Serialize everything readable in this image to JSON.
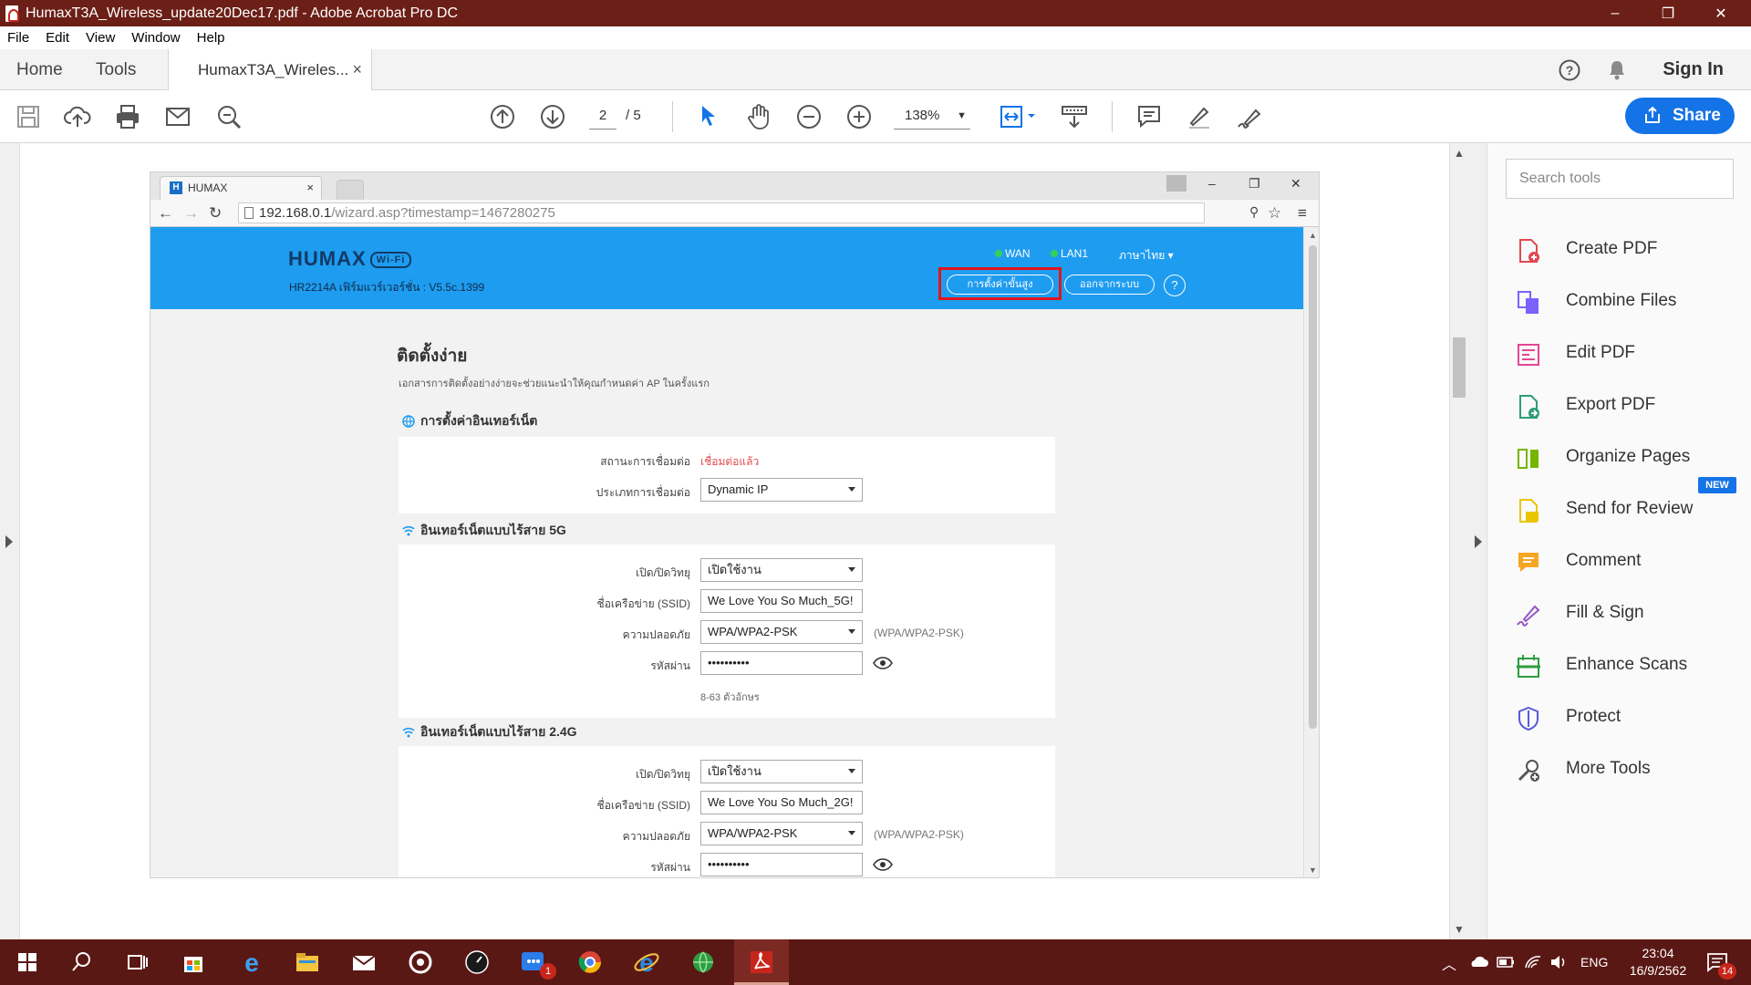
{
  "window": {
    "title": "HumaxT3A_Wireless_update20Dec17.pdf - Adobe Acrobat Pro DC",
    "controls": [
      "–",
      "❐",
      "✕"
    ]
  },
  "menu": [
    "File",
    "Edit",
    "View",
    "Window",
    "Help"
  ],
  "tabs": {
    "home": "Home",
    "tools": "Tools",
    "document": "HumaxT3A_Wireles...",
    "close": "×",
    "sign_in": "Sign In"
  },
  "toolbar": {
    "page_current": "2",
    "page_total": "/ 5",
    "zoom": "138%",
    "share": "Share"
  },
  "screenshot": {
    "browser": {
      "tab_title": "HUMAX",
      "tab_close": "×",
      "url_host": "192.168.0.1",
      "url_path": "/wizard.asp?timestamp=1467280275"
    },
    "header": {
      "logo": "HUMAX",
      "logo_badge": "Wi-Fi",
      "firmware": "HR2214A เฟิร์มแวร์เวอร์ชั่น : V5.5c.1399",
      "wan": "WAN",
      "lan": "LAN1",
      "language": "ภาษาไทย ▾",
      "advanced_button": "การตั้งค่าขั้นสูง",
      "logout_button": "ออกจากระบบ",
      "help": "?"
    },
    "page": {
      "title": "ติดตั้งง่าย",
      "description": "เอกสารการติดตั้งอย่างง่ายจะช่วยแนะนำให้คุณกำหนดค่า AP ในครั้งแรก"
    },
    "internet": {
      "heading": "การตั้งค่าอินเทอร์เน็ต",
      "status_label": "สถานะการเชื่อมต่อ",
      "status_value": "เชื่อมต่อแล้ว",
      "type_label": "ประเภทการเชื่อมต่อ",
      "type_value": "Dynamic IP"
    },
    "wifi5g": {
      "heading": "อินเทอร์เน็ตแบบไร้สาย 5G",
      "radio_label": "เปิด/ปิดวิทยุ",
      "radio_value": "เปิดใช้งาน",
      "ssid_label": "ชื่อเครือข่าย (SSID)",
      "ssid_value": "We Love You So Much_5G!",
      "security_label": "ความปลอดภัย",
      "security_value": "WPA/WPA2-PSK",
      "security_note": "(WPA/WPA2-PSK)",
      "password_label": "รหัสผ่าน",
      "password_value": "••••••••••",
      "password_hint": "8-63 ตัวอักษร"
    },
    "wifi24g": {
      "heading": "อินเทอร์เน็ตแบบไร้สาย 2.4G",
      "radio_label": "เปิด/ปิดวิทยุ",
      "radio_value": "เปิดใช้งาน",
      "ssid_label": "ชื่อเครือข่าย (SSID)",
      "ssid_value": "We Love You So Much_2G!",
      "security_label": "ความปลอดภัย",
      "security_value": "WPA/WPA2-PSK",
      "security_note": "(WPA/WPA2-PSK)",
      "password_label": "รหัสผ่าน",
      "password_value": "••••••••••"
    }
  },
  "right_panel": {
    "search_placeholder": "Search tools",
    "items": [
      {
        "label": "Create PDF",
        "icon": "create-pdf-icon",
        "color": "#e34850"
      },
      {
        "label": "Combine Files",
        "icon": "combine-files-icon",
        "color": "#7b61ff"
      },
      {
        "label": "Edit PDF",
        "icon": "edit-pdf-icon",
        "color": "#e34890"
      },
      {
        "label": "Export PDF",
        "icon": "export-pdf-icon",
        "color": "#2d9d78"
      },
      {
        "label": "Organize Pages",
        "icon": "organize-pages-icon",
        "color": "#75b500"
      },
      {
        "label": "Send for Review",
        "icon": "send-for-review-icon",
        "color": "#e8c600"
      },
      {
        "label": "Comment",
        "icon": "comment-icon",
        "color": "#f5a623"
      },
      {
        "label": "Fill & Sign",
        "icon": "fill-sign-icon",
        "color": "#9457c4"
      },
      {
        "label": "Enhance Scans",
        "icon": "enhance-scans-icon",
        "color": "#2d9d40"
      },
      {
        "label": "Protect",
        "icon": "protect-icon",
        "color": "#5a5ad6"
      },
      {
        "label": "More Tools",
        "icon": "more-tools-icon",
        "color": "#555555"
      }
    ],
    "new_badge": "NEW"
  },
  "taskbar": {
    "language": "ENG",
    "time": "23:04",
    "date": "16/9/2562",
    "messenger_badge": "1",
    "notification_badge": "14"
  },
  "colors": {
    "titlebar": "#6b1f16",
    "taskbar": "#5a1815",
    "accent": "#1473e6",
    "humax_header": "#1e9cf0",
    "highlight": "#e0151c"
  }
}
